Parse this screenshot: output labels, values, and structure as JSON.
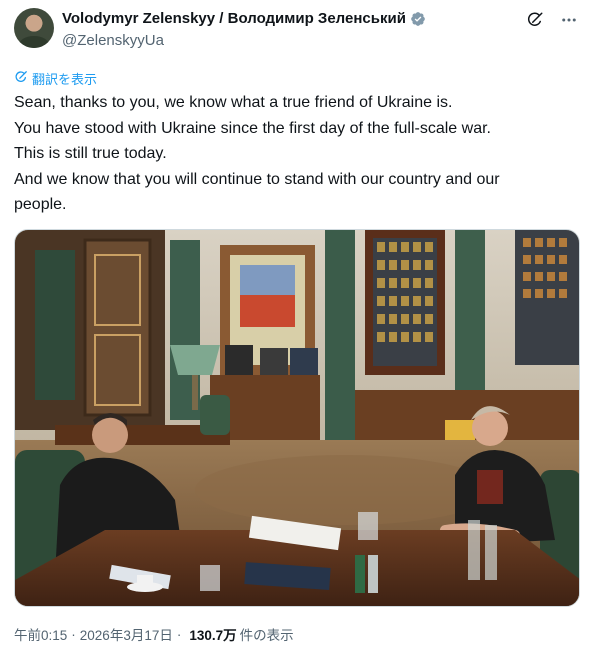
{
  "author": {
    "display_name": "Volodymyr Zelenskyy / Володимир Зеленський",
    "handle": "@ZelenskyyUa",
    "verified": true
  },
  "icons": {
    "avatar": "user-avatar",
    "verified": "verified-badge-icon",
    "grok": "grok-icon",
    "more": "more-options-icon",
    "translate": "translate-icon"
  },
  "translate_label": "翻訳を表示",
  "tweet": {
    "lines": [
      "Sean, thanks to you, we know what a true friend of Ukraine is.",
      "You have stood with Ukraine since the first day of the full-scale war.",
      "This is still true today.",
      "And we know that you will continue to stand with our country and our",
      "people."
    ]
  },
  "media": {
    "description": "photo"
  },
  "meta": {
    "time": "午前0:15",
    "separator": "·",
    "date": "2026年3月17日",
    "views_count": "130.7万",
    "views_label": "件の表示"
  },
  "colors": {
    "link": "#1d9bf0",
    "verified": "#829aab",
    "secondary_text": "#536471",
    "primary_text": "#0f1419"
  }
}
